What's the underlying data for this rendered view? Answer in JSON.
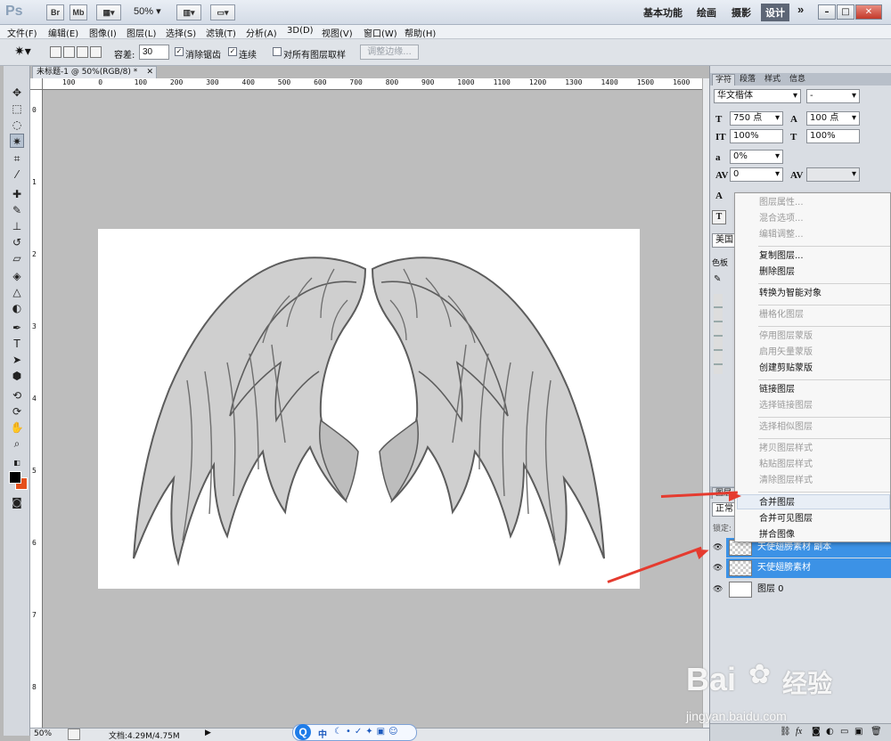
{
  "titlebar": {
    "logo": "Ps",
    "br_badge": "Br",
    "mb_badge": "Mb",
    "zoom": "50%",
    "workspaces": [
      "基本功能",
      "绘画",
      "摄影",
      "设计"
    ],
    "active_workspace": "设计",
    "more": "»"
  },
  "menu": [
    "文件(F)",
    "编辑(E)",
    "图像(I)",
    "图层(L)",
    "选择(S)",
    "滤镜(T)",
    "分析(A)",
    "3D(D)",
    "视图(V)",
    "窗口(W)",
    "帮助(H)"
  ],
  "options": {
    "tolerance_label": "容差:",
    "tolerance_value": "30",
    "antialias_label": "消除锯齿",
    "contiguous_label": "连续",
    "sample_all_label": "对所有图层取样",
    "refine_edge_label": "调整边缘..."
  },
  "document": {
    "tab_title": "未标题-1 @ 50%(RGB/8) *",
    "ruler_h": [
      "100",
      "0",
      "100",
      "200",
      "300",
      "400",
      "500",
      "600",
      "700",
      "800",
      "900",
      "1000",
      "1100",
      "1200",
      "1300",
      "1400",
      "1500",
      "1600"
    ],
    "ruler_v": [
      "0",
      "1",
      "2",
      "3",
      "4",
      "5",
      "6",
      "7",
      "8",
      "9"
    ]
  },
  "status": {
    "zoom": "50%",
    "doc_size": "文档:4.29M/4.75M"
  },
  "ime": {
    "lang": "中"
  },
  "char_panel": {
    "tabs": [
      "字符",
      "段落",
      "样式",
      "信息"
    ],
    "font_family": "华文楷体",
    "font_style": "-",
    "font_size": "750 点",
    "leading": "100 点",
    "vscale": "100%",
    "hscale": "100%",
    "tracking": "0%",
    "kerning": "0",
    "lang": "美国",
    "color_tab": "色板"
  },
  "layers_panel": {
    "tab": "图层",
    "blend_mode": "正常",
    "lock_label": "锁定:",
    "layers": [
      {
        "name": "天使翅膀素材 副本",
        "selected": true
      },
      {
        "name": "天使翅膀素材",
        "selected": true
      },
      {
        "name": "图层 0",
        "selected": false
      }
    ],
    "footer_fx": "fx"
  },
  "context_menu": {
    "items": [
      {
        "label": "图层属性...",
        "enabled": false
      },
      {
        "label": "混合选项...",
        "enabled": false
      },
      {
        "label": "编辑调整...",
        "enabled": false
      },
      {
        "label": "复制图层...",
        "enabled": true
      },
      {
        "label": "删除图层",
        "enabled": true
      },
      {
        "label": "转换为智能对象",
        "enabled": true
      },
      {
        "label": "栅格化图层",
        "enabled": false
      },
      {
        "label": "停用图层蒙版",
        "enabled": false
      },
      {
        "label": "启用矢量蒙版",
        "enabled": false
      },
      {
        "label": "创建剪贴蒙版",
        "enabled": true
      },
      {
        "label": "链接图层",
        "enabled": true
      },
      {
        "label": "选择链接图层",
        "enabled": false
      },
      {
        "label": "选择相似图层",
        "enabled": false
      },
      {
        "label": "拷贝图层样式",
        "enabled": false
      },
      {
        "label": "粘贴图层样式",
        "enabled": false
      },
      {
        "label": "清除图层样式",
        "enabled": false
      },
      {
        "label": "合并图层",
        "enabled": true
      },
      {
        "label": "合并可见图层",
        "enabled": true
      },
      {
        "label": "拼合图像",
        "enabled": true
      }
    ],
    "highlighted": "合并图层"
  },
  "watermark": {
    "brand": "Bai",
    "brand_cn": "经验",
    "url": "jingyan.baidu.com"
  },
  "colors": {
    "selection": "#3c92e6",
    "arrow": "#e53b2f",
    "foreground": "#000000",
    "background": "#e5501b"
  }
}
